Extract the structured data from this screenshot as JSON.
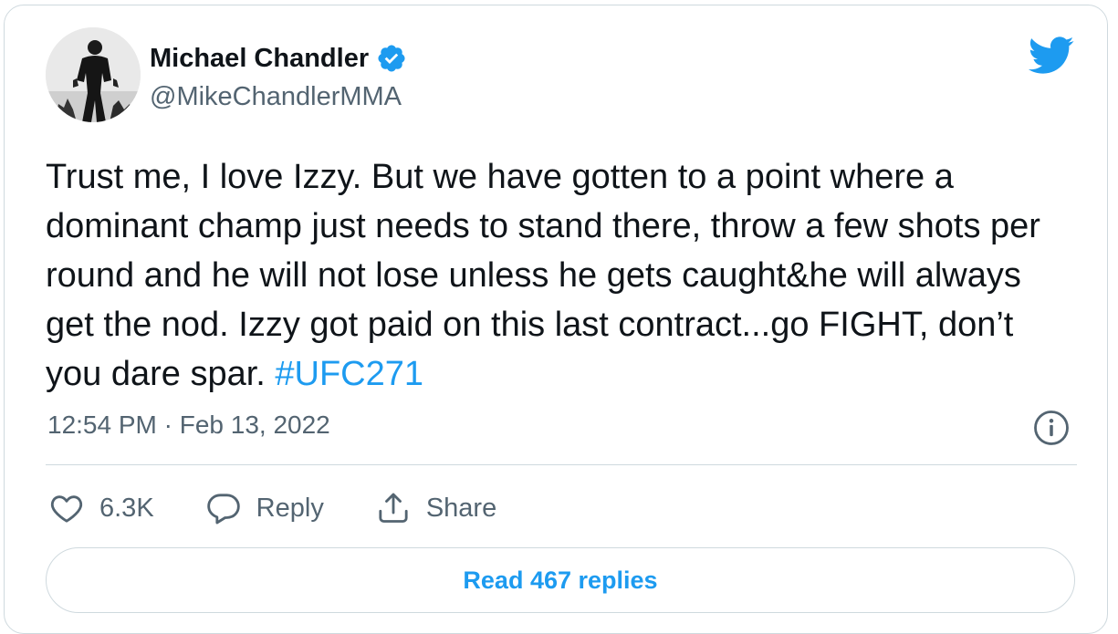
{
  "author": {
    "name": "Michael Chandler",
    "handle": "@MikeChandlerMMA",
    "verified": true
  },
  "tweet": {
    "text": "Trust me, I love Izzy. But we have gotten to a point where a dominant champ just needs to stand there, throw a few shots per round and he will not lose unless he gets caught&he will always get the nod. Izzy got paid on this last contract...go FIGHT, don’t you dare spar.",
    "hashtag": "#UFC271",
    "timestamp": "12:54 PM · Feb 13, 2022"
  },
  "actions": {
    "like_count": "6.3K",
    "reply_label": "Reply",
    "share_label": "Share"
  },
  "read_replies_label": "Read 467 replies",
  "colors": {
    "accent": "#1d9bf0",
    "secondary_text": "#536471",
    "border": "#cfd9de"
  },
  "icons": {
    "brand": "twitter-bird-icon",
    "verified": "verified-badge-icon",
    "info": "info-icon",
    "like": "heart-icon",
    "reply": "speech-bubble-icon",
    "share": "share-icon"
  }
}
